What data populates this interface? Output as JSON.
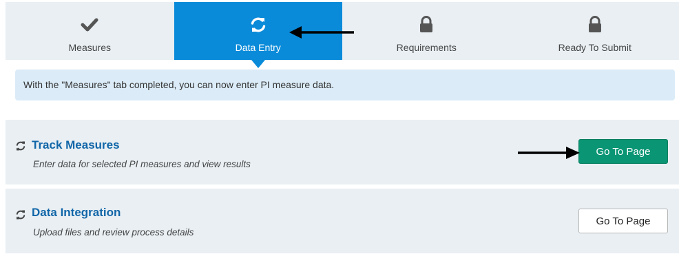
{
  "steps": [
    {
      "label": "Measures",
      "icon": "check-icon",
      "state": "completed"
    },
    {
      "label": "Data Entry",
      "icon": "refresh-icon",
      "state": "active"
    },
    {
      "label": "Requirements",
      "icon": "lock-icon",
      "state": "locked"
    },
    {
      "label": "Ready To Submit",
      "icon": "lock-icon",
      "state": "locked"
    }
  ],
  "info_message": "With the \"Measures\" tab completed, you can now enter PI measure data.",
  "cards": [
    {
      "title": "Track Measures",
      "description": "Enter data for selected PI measures and view results",
      "button_label": "Go To Page",
      "icon": "refresh-icon"
    },
    {
      "title": "Data Integration",
      "description": "Upload files and review process details",
      "button_label": "Go To Page",
      "icon": "refresh-icon"
    }
  ],
  "colors": {
    "active_tab": "#0a8bd9",
    "primary_button": "#0a9574",
    "title_link": "#1166a8",
    "info_background": "#dbecf8",
    "panel_background": "#e9eff3"
  }
}
